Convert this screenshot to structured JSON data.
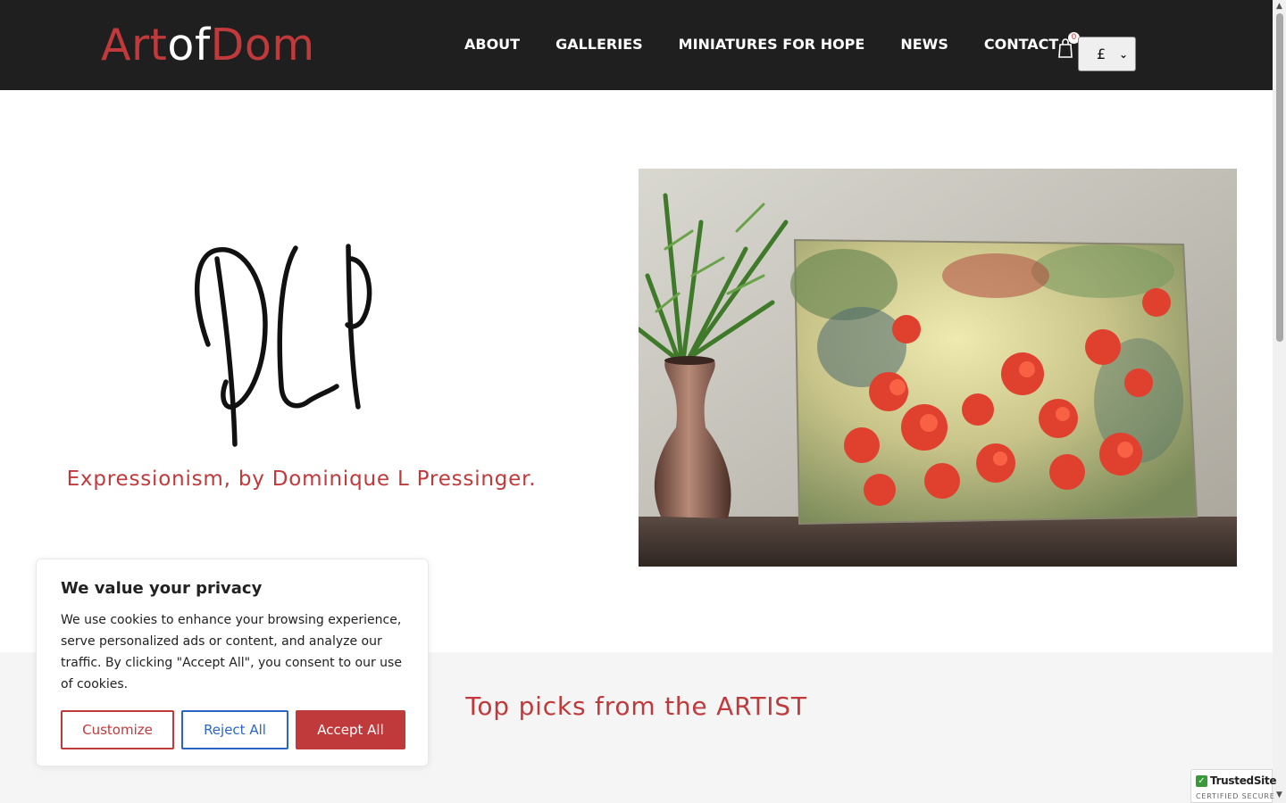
{
  "header": {
    "logo": {
      "part1": "Art",
      "part2": "of",
      "part3": "Dom"
    },
    "nav": [
      {
        "label": "ABOUT"
      },
      {
        "label": "GALLERIES"
      },
      {
        "label": "MINIATURES FOR HOPE"
      },
      {
        "label": "NEWS"
      },
      {
        "label": "CONTACT"
      }
    ],
    "cart": {
      "count": "0",
      "icon": "shopping-bag-icon"
    },
    "currency": {
      "selected": "£"
    }
  },
  "hero": {
    "signature_icon": "dlp-signature-logo",
    "tagline": "Expressionism, by Dominique L Pressinger.",
    "image_icon": "painting-red-flowers-with-vase"
  },
  "picks": {
    "title": "Top picks from the ARTIST"
  },
  "cookie": {
    "title": "We value your privacy",
    "text": "We use cookies to enhance your browsing experience, serve personalized ads or content, and analyze our traffic. By clicking \"Accept All\", you consent to our use of cookies.",
    "customize": "Customize",
    "reject": "Reject All",
    "accept": "Accept All"
  },
  "badge": {
    "name": "TrustedSite",
    "sub": "CERTIFIED SECURE"
  },
  "colors": {
    "brand_red": "#c0393b",
    "header_bg": "#1f1f1f",
    "reject_blue": "#2a66c6"
  }
}
